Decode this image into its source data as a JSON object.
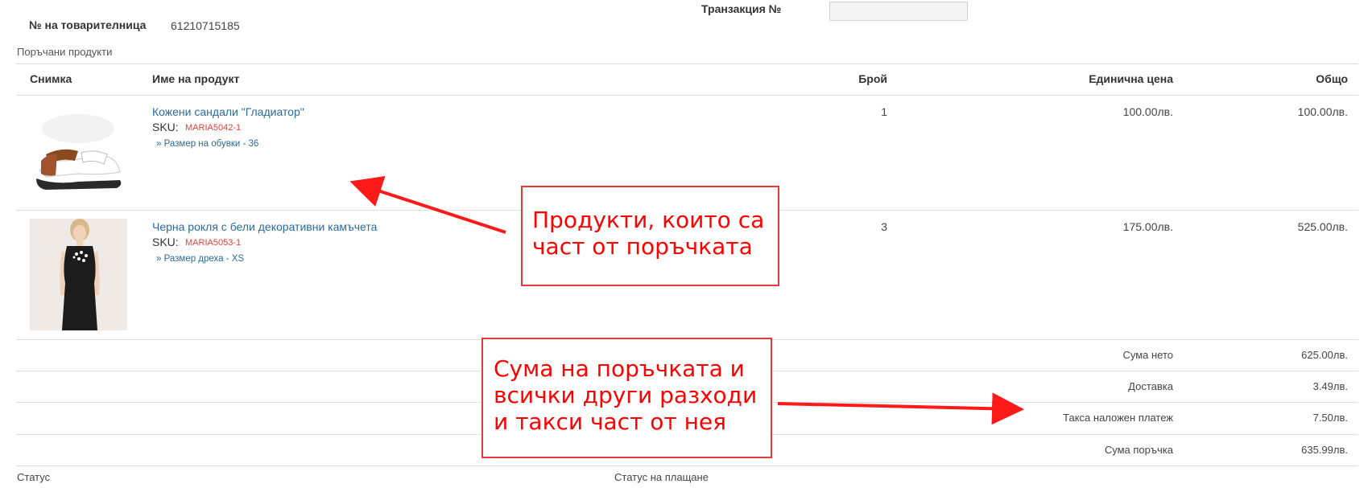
{
  "header": {
    "waybill_label": "№ на товарителница",
    "waybill_value": "61210715185",
    "transaction_label": "Транзакция №",
    "transaction_value": ""
  },
  "section_title": "Поръчани продукти",
  "table": {
    "columns": [
      "Снимка",
      "Име на продукт",
      "Брой",
      "Единична цена",
      "Общо"
    ],
    "rows": [
      {
        "name": "Кожени сандали \"Гладиатор\"",
        "sku_label": "SKU:",
        "sku": "MARIA5042-1",
        "option": "» Размер на обувки - 36",
        "qty": "1",
        "unit_price": "100.00лв.",
        "total": "100.00лв."
      },
      {
        "name": "Черна рокля с бели декоративни камъчета",
        "sku_label": "SKU:",
        "sku": "MARIA5053-1",
        "option": "» Размер дреха - XS",
        "qty": "3",
        "unit_price": "175.00лв.",
        "total": "525.00лв."
      }
    ],
    "totals": [
      {
        "label": "Сума нето",
        "value": "625.00лв."
      },
      {
        "label": "Доставка",
        "value": "3.49лв."
      },
      {
        "label": "Такса наложен платеж",
        "value": "7.50лв."
      },
      {
        "label": "Сума поръчка",
        "value": "635.99лв."
      }
    ]
  },
  "footer": {
    "status_label": "Статус",
    "payment_status_label": "Статус на плащане"
  },
  "annotations": {
    "products_note_line1": "Продукти, които са",
    "products_note_line2": "част от поръчката",
    "totals_note_line1": "Сума на поръчката и",
    "totals_note_line2": "всички други разходи",
    "totals_note_line3": "и такси част от нея"
  },
  "colors": {
    "annotation": "#ff0000",
    "link": "#2a6a9e",
    "sku": "#e0403a"
  }
}
